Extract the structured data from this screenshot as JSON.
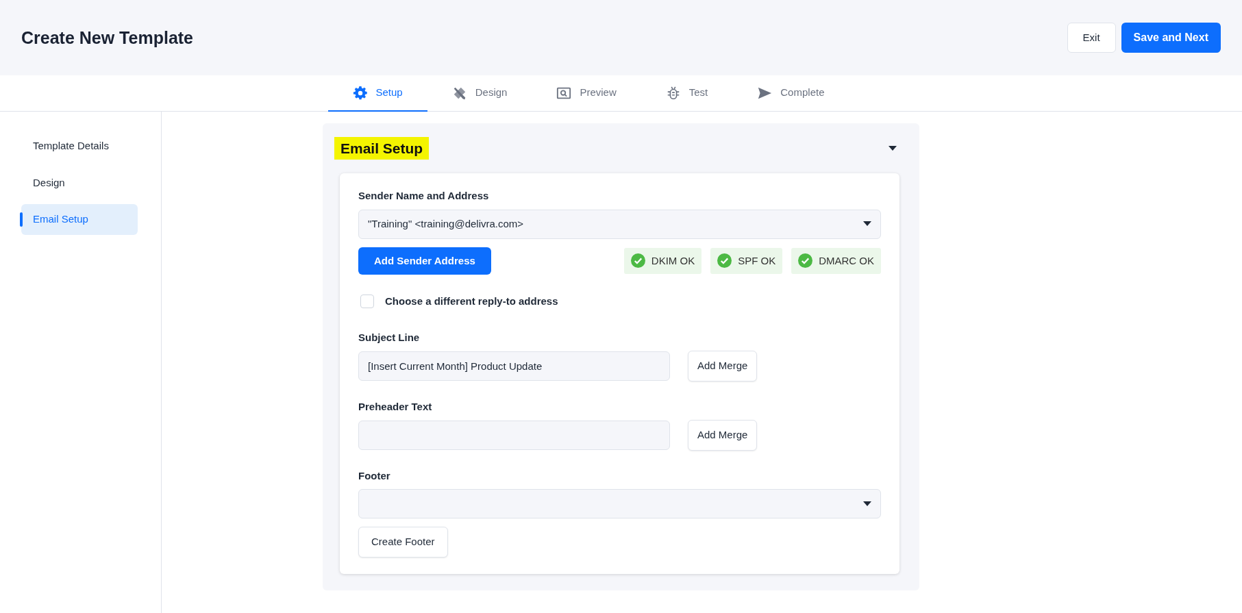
{
  "header": {
    "title": "Create New Template",
    "buttons": [
      {
        "label": "Exit",
        "kind": "secondary"
      },
      {
        "label": "Save and Next",
        "kind": "primary"
      }
    ]
  },
  "tabs": [
    {
      "label": "Setup",
      "kind": "gear",
      "selected": true
    },
    {
      "label": "Design",
      "kind": "tools",
      "selected": false
    },
    {
      "label": "Preview",
      "kind": "preview",
      "selected": false
    },
    {
      "label": "Test",
      "kind": "bug",
      "selected": false
    },
    {
      "label": "Complete",
      "kind": "send",
      "selected": false
    }
  ],
  "sidebar": {
    "items": [
      {
        "label": "Template Details",
        "selected": false
      },
      {
        "label": "Design",
        "selected": false
      },
      {
        "label": "Email Setup",
        "selected": true
      }
    ]
  },
  "section": {
    "title": "Email Setup",
    "expanded": true,
    "sender": {
      "label": "Sender Name and Address",
      "value": "\"Training\" <training@delivra.com>",
      "button": "Add Sender Address",
      "checks": [
        {
          "label": "DKIM OK",
          "ok": true
        },
        {
          "label": "SPF OK",
          "ok": true
        },
        {
          "label": "DMARC OK",
          "ok": true
        }
      ]
    },
    "reply_to": {
      "label": "Choose a different reply-to address",
      "checked": false
    },
    "subject": {
      "label": "Subject Line",
      "value": "[Insert Current Month] Product Update",
      "button": "Add Merge"
    },
    "preheader": {
      "label": "Preheader Text",
      "button": "Add Merge"
    },
    "footer": {
      "label": "Footer",
      "button": "Create Footer"
    }
  }
}
